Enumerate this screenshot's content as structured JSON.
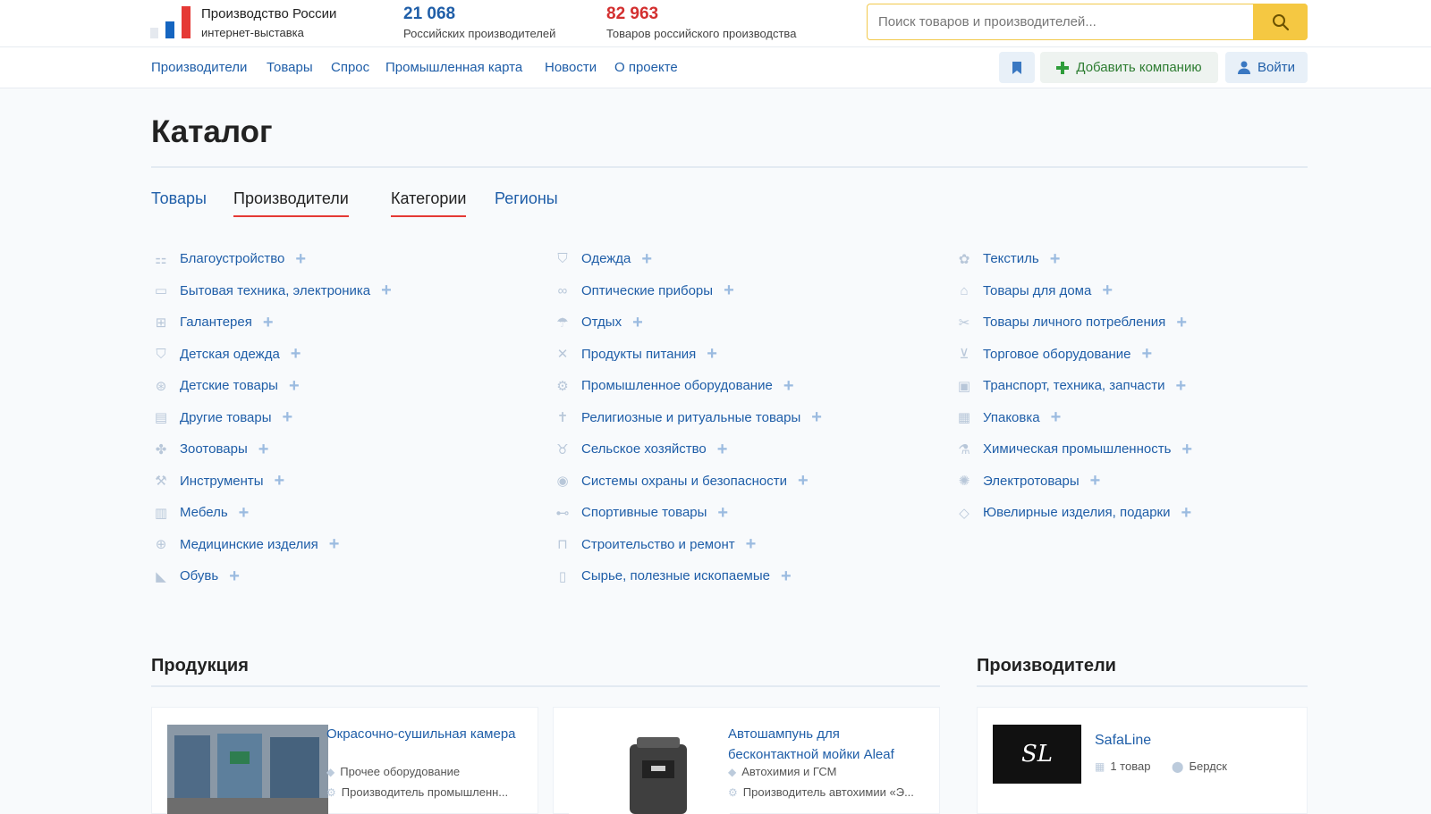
{
  "header": {
    "brand_title": "Производство России",
    "brand_sub": "интернет-выставка",
    "stats": [
      {
        "value": "21 068",
        "label": "Российских производителей",
        "color": "#1f5ea8"
      },
      {
        "value": "82 963",
        "label": "Товаров российского производства",
        "color": "#d32f2f"
      }
    ],
    "search_placeholder": "Поиск товаров и производителей..."
  },
  "nav": {
    "links": [
      "Производители",
      "Товары",
      "Спрос",
      "Промышленная карта",
      "Новости",
      "О проекте"
    ],
    "add_company": "Добавить компанию",
    "login": "Войти"
  },
  "catalog": {
    "title": "Каталог",
    "tabs": [
      "Товары",
      "Производители",
      "Категории",
      "Регионы"
    ],
    "active_tabs": [
      "Производители",
      "Категории"
    ],
    "columns": [
      [
        {
          "label": "Благоустройство",
          "icon": "bench-icon"
        },
        {
          "label": "Бытовая техника, электроника",
          "icon": "monitor-icon"
        },
        {
          "label": "Галантерея",
          "icon": "bag-icon"
        },
        {
          "label": "Детская одежда",
          "icon": "shirt-icon"
        },
        {
          "label": "Детские товары",
          "icon": "stroller-icon"
        },
        {
          "label": "Другие товары",
          "icon": "box-icon"
        },
        {
          "label": "Зоотовары",
          "icon": "paw-icon"
        },
        {
          "label": "Инструменты",
          "icon": "wrench-icon"
        },
        {
          "label": "Мебель",
          "icon": "furniture-icon"
        },
        {
          "label": "Медицинские изделия",
          "icon": "medkit-icon"
        },
        {
          "label": "Обувь",
          "icon": "shoe-icon"
        }
      ],
      [
        {
          "label": "Одежда",
          "icon": "shirt-icon"
        },
        {
          "label": "Оптические приборы",
          "icon": "binoculars-icon"
        },
        {
          "label": "Отдых",
          "icon": "umbrella-icon"
        },
        {
          "label": "Продукты питания",
          "icon": "cutlery-icon"
        },
        {
          "label": "Промышленное оборудование",
          "icon": "gear-icon"
        },
        {
          "label": "Религиозные и ритуальные товары",
          "icon": "cross-icon"
        },
        {
          "label": "Сельское хозяйство",
          "icon": "cow-icon"
        },
        {
          "label": "Системы охраны и безопасности",
          "icon": "camera-icon"
        },
        {
          "label": "Спортивные товары",
          "icon": "dumbbell-icon"
        },
        {
          "label": "Строительство и ремонт",
          "icon": "crane-icon"
        },
        {
          "label": "Сырье, полезные ископаемые",
          "icon": "barrel-icon"
        }
      ],
      [
        {
          "label": "Текстиль",
          "icon": "yarn-icon"
        },
        {
          "label": "Товары для дома",
          "icon": "house-icon"
        },
        {
          "label": "Товары личного потребления",
          "icon": "scissors-icon"
        },
        {
          "label": "Торговое оборудование",
          "icon": "cart-icon"
        },
        {
          "label": "Транспорт, техника, запчасти",
          "icon": "bus-icon"
        },
        {
          "label": "Упаковка",
          "icon": "package-icon"
        },
        {
          "label": "Химическая промышленность",
          "icon": "flask-icon"
        },
        {
          "label": "Электротовары",
          "icon": "bulb-icon"
        },
        {
          "label": "Ювелирные изделия, подарки",
          "icon": "diamond-icon"
        }
      ]
    ]
  },
  "products": {
    "title": "Продукция",
    "cards": [
      {
        "title": "Окрасочно-сушильная камера",
        "category": "Прочее оборудование",
        "producer": "Производитель промышленн..."
      },
      {
        "title": "Автошампунь для бесконтактной мойки Aleaf",
        "category": "Автохимия и ГСМ",
        "producer": "Производитель автохимии «Э..."
      }
    ]
  },
  "manufacturers": {
    "title": "Производители",
    "cards": [
      {
        "name": "SafaLine",
        "logo_text": "SL",
        "goods": "1 товар",
        "city": "Бердск"
      }
    ]
  }
}
